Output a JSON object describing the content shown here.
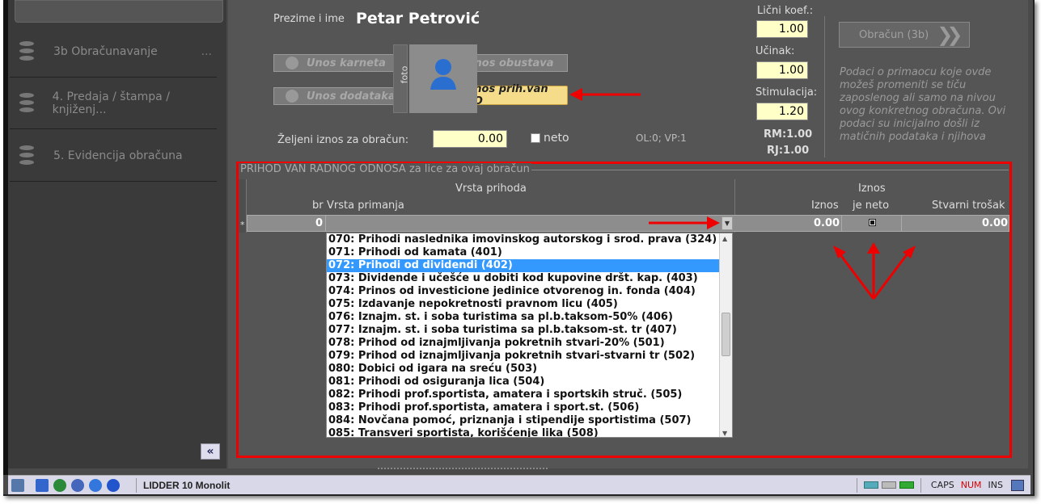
{
  "sidebar": {
    "items": [
      {
        "label": "3b Obračunavanje"
      },
      {
        "label": "4. Predaja / štampa / knjiženj..."
      },
      {
        "label": "5. Evidencija obračuna"
      }
    ],
    "dots": "...",
    "collapse_glyph": "«"
  },
  "employee": {
    "name_label": "Prezime i ime",
    "name_value": "Petar Petrović"
  },
  "buttons": {
    "unos_karneta": "Unos karneta",
    "unos_obustava": "Unos obustava",
    "unos_dodataka": "Unos dodataka",
    "unos_prih_van_ro": "Unos prih.van RO",
    "obracun": "Obračun (3b)"
  },
  "foto_label": "foto",
  "coef": {
    "licni_label": "Lični koef.:",
    "licni_value": "1.00",
    "ucinak_label": "Učinak:",
    "ucinak_value": "1.00",
    "stim_label": "Stimulacija:",
    "stim_value": "1.20",
    "rm": "RM:1.00",
    "rj": "RJ:1.00"
  },
  "zeljeni": {
    "label": "Željeni iznos za obračun:",
    "value": "0.00",
    "neto_label": "neto"
  },
  "olvp": "OL:0;  VP:1",
  "note": "Podaci o primaocu koje ovde možeš promeniti se tiču zaposlenog ali samo na nivou ovog konkretnog obračuna. Ovi podaci su inicijalno došli iz matičnih podataka i njihova",
  "section": {
    "title": "PRIHOD VAN RADNOG ODNOSA za lice za ovaj obračun",
    "group_vrsta": "Vrsta prihoda",
    "group_iznos": "Iznos",
    "col_br": "br",
    "col_vrsta": "Vrsta primanja",
    "col_iznos": "Iznos",
    "col_neto": "je neto",
    "col_trosak": "Stvarni trošak",
    "row": {
      "marker": "*",
      "br": "0",
      "iznos": "0.00",
      "trosak": "0.00"
    }
  },
  "dropdown": [
    "070: Prihodi naslednika imovinskog autorskog i srod. prava (324)",
    "071: Prihodi od kamata (401)",
    "072: Prihodi od dividendi (402)",
    "073: Dividende i učešće u dobiti kod kupovine dršt. kap. (403)",
    "074: Prinos od investicione jedinice otvorenog in. fonda (404)",
    "075: Izdavanje nepokretnosti pravnom licu (405)",
    "076: Iznajm. st. i soba turistima sa pl.b.taksom-50% (406)",
    "077: Iznajm. st. i soba turistima sa pl.b.taksom-st. tr (407)",
    "078: Prihod od iznajmljivanja pokretnih stvari-20% (501)",
    "079: Prihod od iznajmljivanja pokretnih stvari-stvarni tr (502)",
    "080: Dobici od igara na sreću (503)",
    "081: Prihodi od osiguranja lica (504)",
    "082: Prihodi prof.sportista, amatera i sportskih struč. (505)",
    "083: Prihodi prof.sportista, amatera i sport.st. (506)",
    "084: Novčana pomoć, priznanja i stipendije sportistima (507)",
    "085: Transveri sportista, korišćenje lika (508)"
  ],
  "dropdown_selected_index": 2,
  "status": {
    "app": "LIDDER 10 Monolit",
    "caps": "CAPS",
    "num": "NUM",
    "ins": "INS"
  },
  "colors": {
    "highlight": "#3399ff",
    "annotation_red": "#ee0000",
    "input_yellow": "#ffffc8"
  }
}
